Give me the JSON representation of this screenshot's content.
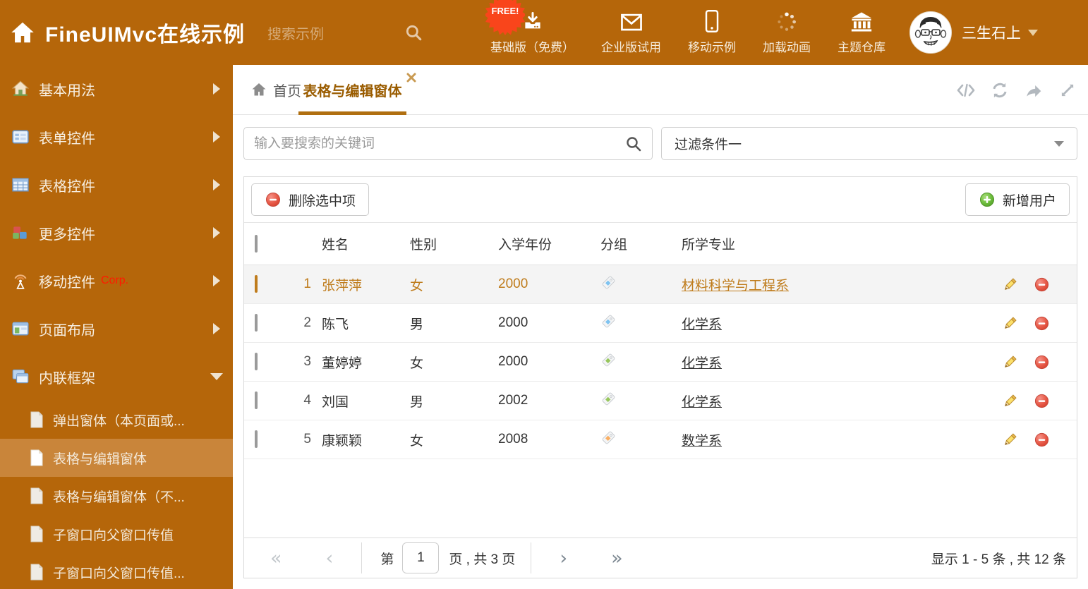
{
  "colors": {
    "theme_orange": "#B5660A",
    "sidebar_active_bg": "#C9853A",
    "free_badge_red": "#F9451B",
    "active_tab_text": "#9A5C00",
    "active_tab_underline": "#B06F10",
    "selected_row_text": "#BF7C1C"
  },
  "header": {
    "title": "FineUIMvc在线示例",
    "search_placeholder": "搜索示例",
    "free_badge": "FREE!",
    "nav": [
      {
        "label": "基础版（免费）",
        "icon": "download-icon"
      },
      {
        "label": "企业版试用",
        "icon": "envelope-icon"
      },
      {
        "label": "移动示例",
        "icon": "mobile-icon"
      },
      {
        "label": "加载动画",
        "icon": "spinner-icon"
      },
      {
        "label": "主题仓库",
        "icon": "bank-icon"
      }
    ],
    "username": "三生石上"
  },
  "sidebar": {
    "items": [
      {
        "label": "基本用法",
        "icon": "home-icon"
      },
      {
        "label": "表单控件",
        "icon": "form-icon"
      },
      {
        "label": "表格控件",
        "icon": "table-icon"
      },
      {
        "label": "更多控件",
        "icon": "cubes-icon"
      },
      {
        "label": "移动控件",
        "icon": "antenna-icon",
        "badge": "Corp."
      },
      {
        "label": "页面布局",
        "icon": "layout-icon"
      },
      {
        "label": "内联框架",
        "icon": "frames-icon",
        "expanded": true
      }
    ],
    "subitems": [
      {
        "label": "弹出窗体（本页面或...",
        "selected": false
      },
      {
        "label": "表格与编辑窗体",
        "selected": true
      },
      {
        "label": "表格与编辑窗体（不...",
        "selected": false
      },
      {
        "label": "子窗口向父窗口传值",
        "selected": false
      },
      {
        "label": "子窗口向父窗口传值...",
        "selected": false
      }
    ]
  },
  "tabs": {
    "home": "首页",
    "active": "表格与编辑窗体"
  },
  "filters": {
    "search_placeholder": "输入要搜索的关键词",
    "filter_value": "过滤条件一"
  },
  "toolbar": {
    "delete_selected": "删除选中项",
    "add_user": "新增用户"
  },
  "table": {
    "columns": [
      "姓名",
      "性别",
      "入学年份",
      "分组",
      "所学专业"
    ],
    "rows": [
      {
        "num": "1",
        "name": "张萍萍",
        "gender": "女",
        "year": "2000",
        "tag_color": "#7FC3F0",
        "major": "材料科学与工程系",
        "selected": true
      },
      {
        "num": "2",
        "name": "陈飞",
        "gender": "男",
        "year": "2000",
        "tag_color": "#7FC3F0",
        "major": "化学系",
        "selected": false
      },
      {
        "num": "3",
        "name": "董婷婷",
        "gender": "女",
        "year": "2000",
        "tag_color": "#97C65C",
        "major": "化学系",
        "selected": false
      },
      {
        "num": "4",
        "name": "刘国",
        "gender": "男",
        "year": "2002",
        "tag_color": "#97C65C",
        "major": "化学系",
        "selected": false
      },
      {
        "num": "5",
        "name": "康颖颖",
        "gender": "女",
        "year": "2008",
        "tag_color": "#F9AE63",
        "major": "数学系",
        "selected": false
      }
    ]
  },
  "pagination": {
    "first": "«",
    "prev": "‹",
    "next": "›",
    "last": "»",
    "page_prefix": "第",
    "current_page": "1",
    "page_suffix": "页 , 共 3 页",
    "summary": "显示 1 - 5 条 , 共 12 条"
  }
}
